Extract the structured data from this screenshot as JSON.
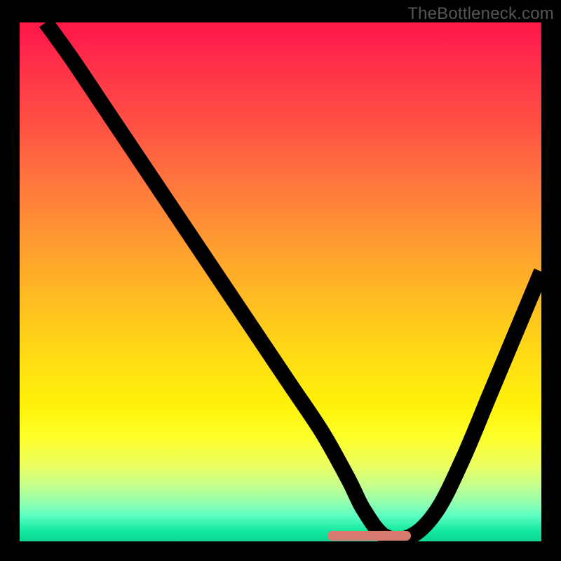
{
  "watermark": "TheBottleneck.com",
  "chart_data": {
    "type": "line",
    "title": "",
    "xlabel": "",
    "ylabel": "",
    "xlim": [
      0,
      100
    ],
    "ylim": [
      0,
      100
    ],
    "grid": false,
    "legend": false,
    "background_gradient": {
      "top": "#ff1a4a",
      "mid": "#ffe012",
      "bottom": "#0fd596"
    },
    "series": [
      {
        "name": "main-curve",
        "color": "#000000",
        "x": [
          5,
          10,
          16,
          22,
          28,
          34,
          40,
          46,
          52,
          58,
          63,
          66,
          70,
          75,
          80,
          85,
          90,
          95,
          100
        ],
        "y": [
          100,
          93,
          84,
          75,
          66,
          57,
          48,
          39,
          30,
          21,
          12,
          6,
          1,
          1,
          6,
          16,
          28,
          40,
          52
        ]
      }
    ],
    "highlight_region": {
      "x_start": 59,
      "x_end": 75,
      "y": 1,
      "color": "#d87a6f"
    }
  }
}
